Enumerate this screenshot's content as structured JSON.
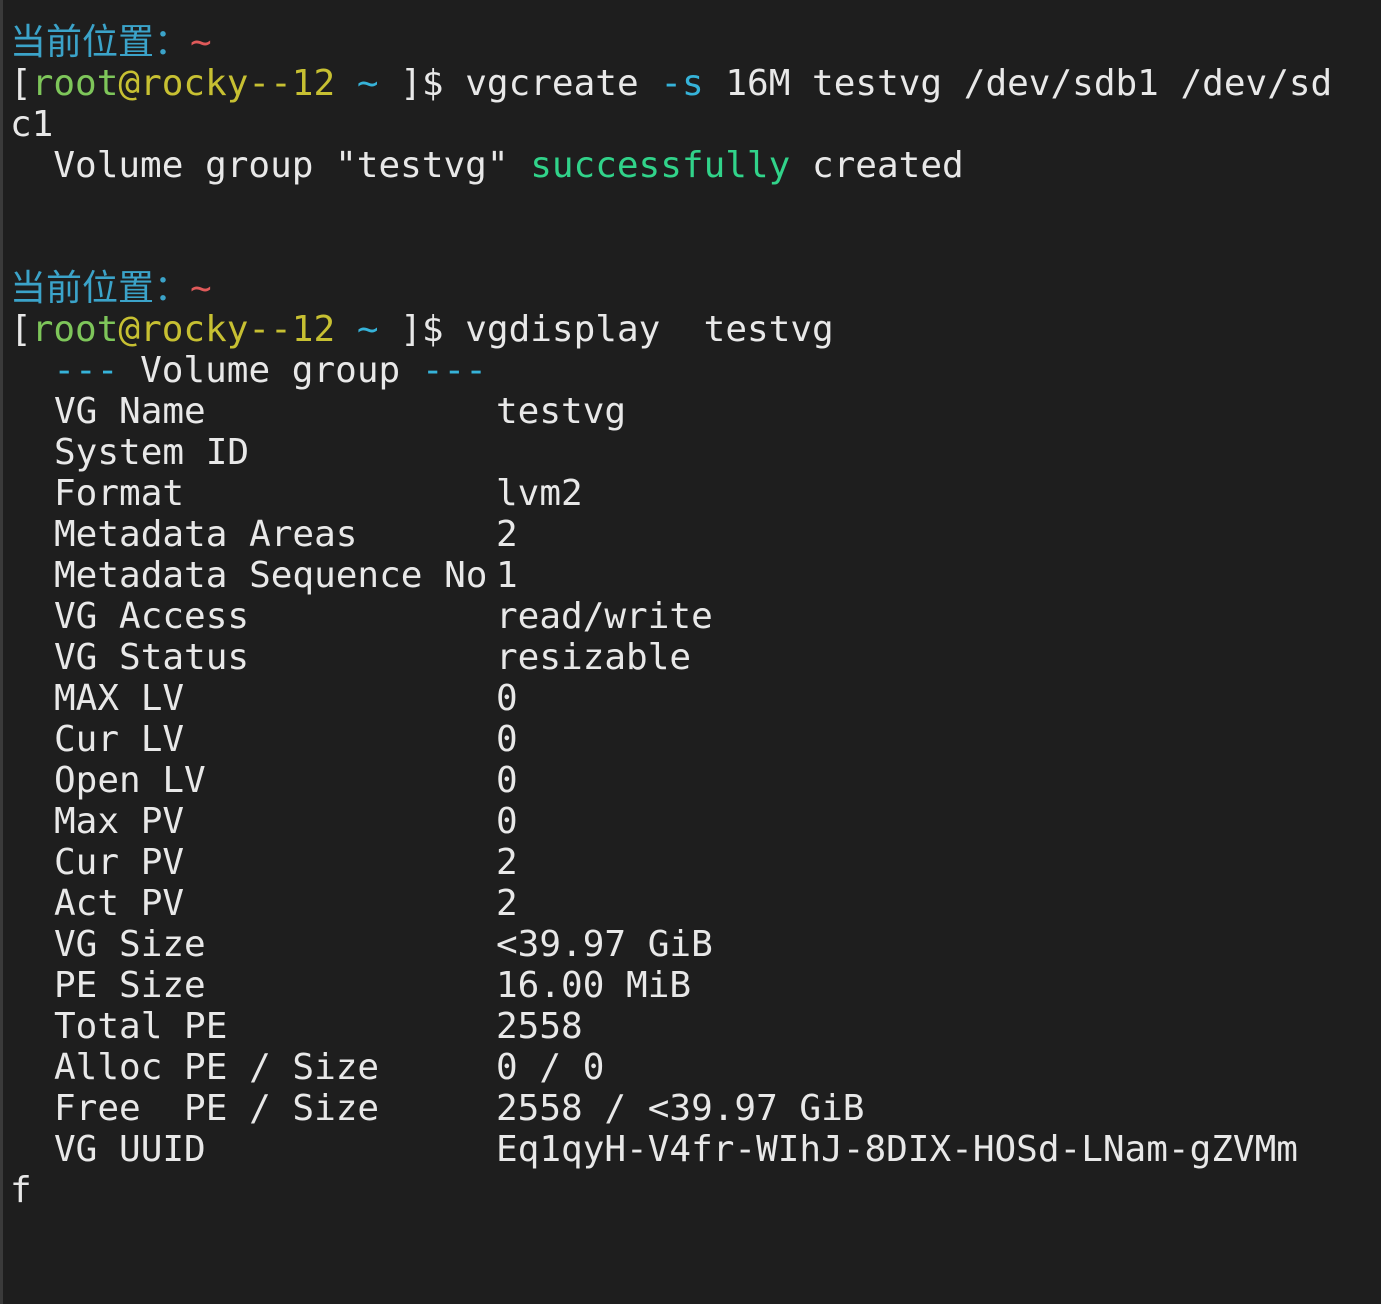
{
  "prompt": {
    "location_label": "当前位置：",
    "location_value": "~",
    "bracket_open": "[",
    "user": "root",
    "at_host": "@rocky--12",
    "cwd": "~",
    "bracket_close_dollar": " ]$"
  },
  "cmd1": {
    "name": "vgcreate",
    "flag": "-s",
    "args": "16M testvg /dev/sdb1 /dev/sd",
    "wrap": "c1"
  },
  "output1": {
    "prefix": "Volume group \"testvg\" ",
    "success": "successfully",
    "suffix": " created"
  },
  "cmd2": {
    "name": "vgdisplay",
    "args": " testvg"
  },
  "vg": {
    "header_dashes": "---",
    "header_title": "Volume group",
    "rows": [
      {
        "key": "VG Name",
        "value": "testvg"
      },
      {
        "key": "System ID",
        "value": ""
      },
      {
        "key": "Format",
        "value": "lvm2"
      },
      {
        "key": "Metadata Areas",
        "value": "2"
      },
      {
        "key": "Metadata Sequence No",
        "value": "1"
      },
      {
        "key": "VG Access",
        "value": "read/write"
      },
      {
        "key": "VG Status",
        "value": "resizable"
      },
      {
        "key": "MAX LV",
        "value": "0"
      },
      {
        "key": "Cur LV",
        "value": "0"
      },
      {
        "key": "Open LV",
        "value": "0"
      },
      {
        "key": "Max PV",
        "value": "0"
      },
      {
        "key": "Cur PV",
        "value": "2"
      },
      {
        "key": "Act PV",
        "value": "2"
      },
      {
        "key": "VG Size",
        "value": "<39.97 GiB"
      },
      {
        "key": "PE Size",
        "value": "16.00 MiB"
      },
      {
        "key": "Total PE",
        "value": "2558"
      },
      {
        "key": "Alloc PE / Size",
        "value": "0 / 0"
      },
      {
        "key": "Free  PE / Size",
        "value": "2558 / <39.97 GiB"
      },
      {
        "key": "VG UUID",
        "value": "Eq1qyH-V4fr-WIhJ-8DIX-HOSd-LNam-gZVMm"
      }
    ],
    "uuid_wrap": "f"
  },
  "colors": {
    "background": "#1e1e1e",
    "text": "#e8e8e8",
    "location_label": "#3ba3c9",
    "tilde": "#e05a5a",
    "user": "#7ec65a",
    "host": "#c7c032",
    "cyan": "#36b3d9",
    "success": "#31d38a"
  }
}
